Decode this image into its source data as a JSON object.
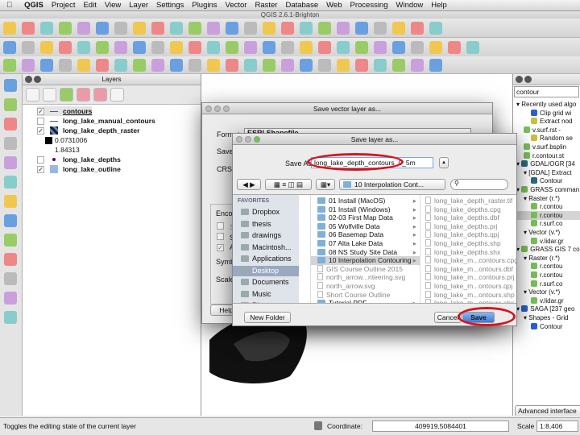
{
  "menubar": {
    "items": [
      "QGIS",
      "Project",
      "Edit",
      "View",
      "Layer",
      "Settings",
      "Plugins",
      "Vector",
      "Raster",
      "Database",
      "Web",
      "Processing",
      "Window",
      "Help"
    ],
    "window_title": "QGIS 2.6.1-Brighton"
  },
  "layers_panel": {
    "title": "Layers",
    "layers": [
      {
        "name": "contours",
        "checked": true,
        "symbol": "line"
      },
      {
        "name": "long_lake_manual_contours",
        "checked": false,
        "symbol": "line"
      },
      {
        "name": "long_lake_depth_raster",
        "checked": true,
        "symbol": "raster",
        "legend": [
          "0.0731006",
          "1.84313"
        ]
      },
      {
        "name": "long_lake_depths",
        "checked": false,
        "symbol": "point"
      },
      {
        "name": "long_lake_outline",
        "checked": true,
        "symbol": "polygon"
      }
    ]
  },
  "save_vector_dialog": {
    "title": "Save vector layer as...",
    "format_label": "Format",
    "format_value": "ESRI Shapefile",
    "save_as_label": "Save a",
    "crs_label": "CRS",
    "encoding_label": "Enco",
    "option1": "Sa",
    "option2": "Sk",
    "option3": "Ad",
    "option3_checked": true,
    "symbology_label": "Symb",
    "scale_label": "Scale",
    "help_button": "Help"
  },
  "save_layer_dialog": {
    "title": "Save layer as...",
    "save_as_label": "Save As:",
    "filename": "long_lake_depth_contours_0_5m",
    "location": "10 Interpolation Cont...",
    "favorites_header": "FAVORITES",
    "favorites": [
      "Dropbox",
      "thesis",
      "drawings",
      "Macintosh...",
      "Applications",
      "Desktop",
      "Documents",
      "Music",
      "Pictures"
    ],
    "selected_favorite": "Desktop",
    "column2": [
      "01 Install (MacOS)",
      "01 Install (Windows)",
      "02-03 First Map Data",
      "05 Wolfville Data",
      "06 Basemap Data",
      "07 Alta Lake Data",
      "08 NS Study Site Data",
      "10 Interpolation Contouring",
      "GIS Course Outline 2015",
      "north_arrow...nteering.svg",
      "north_arrow.svg",
      "Short Course Outline",
      "Tutorial PDF"
    ],
    "selected_folder": "10 Interpolation Contouring",
    "column3": [
      "long_lake_depth_raster.tif",
      "long_lake_depths.cpg",
      "long_lake_depths.dbf",
      "long_lake_depths.prj",
      "long_lake_depths.qpj",
      "long_lake_depths.shp",
      "long_lake_depths.shx",
      "long_lake_m...contours.cpg",
      "long_lake_m...ontours.dbf",
      "long_lake_m...contours.prj",
      "long_lake_m...ontours.qpj",
      "long_lake_m...ontours.shp",
      "long_lake_m...ontours.shx"
    ],
    "new_folder": "New Folder",
    "cancel": "Cancel",
    "save": "Save"
  },
  "processing": {
    "search": "contour",
    "tree": [
      {
        "t": "Recently used algo",
        "l": 0,
        "c": "#fff"
      },
      {
        "t": "Clip grid wi",
        "l": 2,
        "c": "#2b5fd1"
      },
      {
        "t": "Extract nod",
        "l": 2,
        "c": "#c8c040"
      },
      {
        "t": "v.surf.rst - ",
        "l": 1,
        "c": "#7bbf5a"
      },
      {
        "t": "Random se",
        "l": 2,
        "c": "#c8c040"
      },
      {
        "t": "v.surf.bsplin",
        "l": 1,
        "c": "#7bbf5a"
      },
      {
        "t": "r.contour.st",
        "l": 1,
        "c": "#7bbf5a"
      },
      {
        "t": "GDAL/OGR [34",
        "l": 0,
        "c": "#2a6a80"
      },
      {
        "t": "[GDAL] Extract",
        "l": 1,
        "c": "#fff"
      },
      {
        "t": "Contour",
        "l": 2,
        "c": "#2a6a80"
      },
      {
        "t": "GRASS comman",
        "l": 0,
        "c": "#7bbf5a"
      },
      {
        "t": "Raster (r.*)",
        "l": 1,
        "c": "#fff"
      },
      {
        "t": "r.contou",
        "l": 2,
        "c": "#7bbf5a"
      },
      {
        "t": "r.contou",
        "l": 2,
        "c": "#7bbf5a",
        "sel": true
      },
      {
        "t": "r.surf.co",
        "l": 2,
        "c": "#7bbf5a"
      },
      {
        "t": "Vector (v.*)",
        "l": 1,
        "c": "#fff"
      },
      {
        "t": "v.lidar.gr",
        "l": 2,
        "c": "#7bbf5a"
      },
      {
        "t": "GRASS GIS 7 co",
        "l": 0,
        "c": "#7bbf5a"
      },
      {
        "t": "Raster (r.*)",
        "l": 1,
        "c": "#fff"
      },
      {
        "t": "r.contou",
        "l": 2,
        "c": "#7bbf5a"
      },
      {
        "t": "r.contou",
        "l": 2,
        "c": "#7bbf5a"
      },
      {
        "t": "r.surf.co",
        "l": 2,
        "c": "#7bbf5a"
      },
      {
        "t": "Vector (v.*)",
        "l": 1,
        "c": "#fff"
      },
      {
        "t": "v.lidar.gr",
        "l": 2,
        "c": "#7bbf5a"
      },
      {
        "t": "SAGA [237 geo",
        "l": 0,
        "c": "#2b5fd1"
      },
      {
        "t": "Shapes - Grid",
        "l": 1,
        "c": "#fff"
      },
      {
        "t": "Contour",
        "l": 2,
        "c": "#2b5fd1"
      }
    ],
    "advanced_button": "Advanced interface"
  },
  "status": {
    "message": "Toggles the editing state of the current layer",
    "coordinate_label": "Coordinate:",
    "coordinate": "409919,5084401",
    "scale_label": "Scale",
    "scale": "1:8,406"
  },
  "colors": {
    "highlight": "#d8141e",
    "selection": "#3b78d8"
  }
}
